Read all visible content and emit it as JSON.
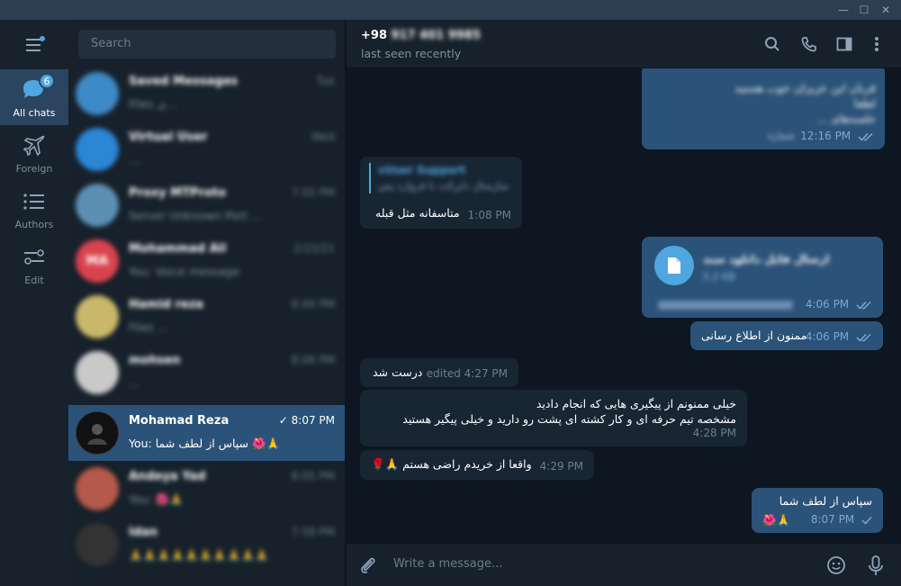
{
  "window": {
    "minimize_glyph": "—",
    "maximize_glyph": "☐",
    "close_glyph": "✕"
  },
  "folders": [
    {
      "label": "All chats",
      "icon": "chats-icon",
      "badge": "6"
    },
    {
      "label": "Foreign",
      "icon": "airplane-icon"
    },
    {
      "label": "Authors",
      "icon": "list-icon"
    },
    {
      "label": "Edit",
      "icon": "sliders-icon"
    }
  ],
  "search": {
    "placeholder": "Search"
  },
  "chats": [
    {
      "avatar_color": "#3e8ac6",
      "initials": "",
      "name": "Saved Messages",
      "time": "Tue",
      "preview": "Files ی...",
      "blurred": true
    },
    {
      "avatar_color": "#2b86d6",
      "initials": "",
      "name": "Virtual User",
      "time": "Wed",
      "preview": "...",
      "blurred": true
    },
    {
      "avatar_color": "#5d8fb5",
      "initials": "",
      "name": "Proxy MTProto",
      "time": "7:55 PM",
      "preview": "Server Unknown Port ...",
      "blurred": true
    },
    {
      "avatar_color": "#d9434e",
      "initials": "MA",
      "name": "Mohammad Ali",
      "time": "2/15/21",
      "preview": "You: Voice message",
      "blurred": true
    },
    {
      "avatar_color": "#c9b86a",
      "initials": "",
      "name": "Hamid reza",
      "time": "8:00 PM",
      "preview": "Files ...",
      "blurred": true
    },
    {
      "avatar_color": "#c9c9c9",
      "initials": "",
      "name": "mohsen",
      "time": "8:06 PM",
      "preview": "...",
      "blurred": true
    },
    {
      "avatar_color": "#111111",
      "initials": "",
      "name": "Mohamad Reza",
      "time": "8:07 PM",
      "preview_prefix": "You:",
      "preview": "سپاس از لطف شما",
      "preview_emoji": "🌺🙏",
      "blurred": false,
      "active": true
    },
    {
      "avatar_color": "#b55a4a",
      "initials": "",
      "name": "Andeya Yad",
      "time": "8:05 PM",
      "preview": "You: 🌺🙏",
      "blurred": true
    },
    {
      "avatar_color": "#333333",
      "initials": "",
      "name": "Idan",
      "time": "7:58 PM",
      "preview": "🙏🙏🙏🙏🙏🙏🙏🙏🙏🙏",
      "blurred": true
    }
  ],
  "header": {
    "title": "+98",
    "title_hidden": "917 401 9985",
    "status": "last seen recently",
    "icons": [
      "search-icon",
      "phone-icon",
      "sidebar-icon",
      "more-icon"
    ]
  },
  "messages": [
    {
      "id": "m1",
      "dir": "out",
      "lines": [
        "قربان این عزیزان خوب هستید",
        "لطفا",
        "جلسه‌های ...",
        "شماره"
      ],
      "time": "12:16 PM",
      "ticks": "double",
      "blurred": true
    },
    {
      "id": "m2",
      "dir": "in",
      "reply_name": "vUser Support",
      "reply_text": "سارسال دایرکت با فروارد پس",
      "text": "متاسفانه مثل قبله",
      "time": "1:08 PM"
    },
    {
      "id": "m3",
      "dir": "out",
      "file_name": "ارسال فایل دانلود سند",
      "file_size": "5.2 KB",
      "caption": "...",
      "time": "4:06 PM",
      "ticks": "double",
      "blurred": true
    },
    {
      "id": "m4",
      "dir": "out",
      "text": "ممنون از اطلاع رسانی",
      "time": "4:06 PM",
      "ticks": "double"
    },
    {
      "id": "m5",
      "dir": "in",
      "text": "درست شد",
      "edited_time": "edited 4:27 PM"
    },
    {
      "id": "m6",
      "dir": "in",
      "lines": [
        "خیلی ممنونم از پیگیری هایی که انجام دادید",
        "مشخصه تیم حرفه ای و کار کشته ای پشت رو دارید و خیلی پیگیر هستید"
      ],
      "time": "4:28 PM"
    },
    {
      "id": "m7",
      "dir": "in",
      "text": "واقعا از خریدم راضی هستم",
      "emoji": "🌹🙏",
      "time": "4:29 PM"
    },
    {
      "id": "m8",
      "dir": "out",
      "text": "سپاس از لطف شما",
      "emoji": "🌺🙏",
      "time": "8:07 PM",
      "ticks": "single"
    }
  ],
  "composer": {
    "placeholder": "Write a message..."
  },
  "colors": {
    "accent": "#4fa6e0",
    "outgoing": "#2b5278",
    "incoming": "#182533",
    "background": "#0e1621",
    "panel": "#17212b"
  }
}
